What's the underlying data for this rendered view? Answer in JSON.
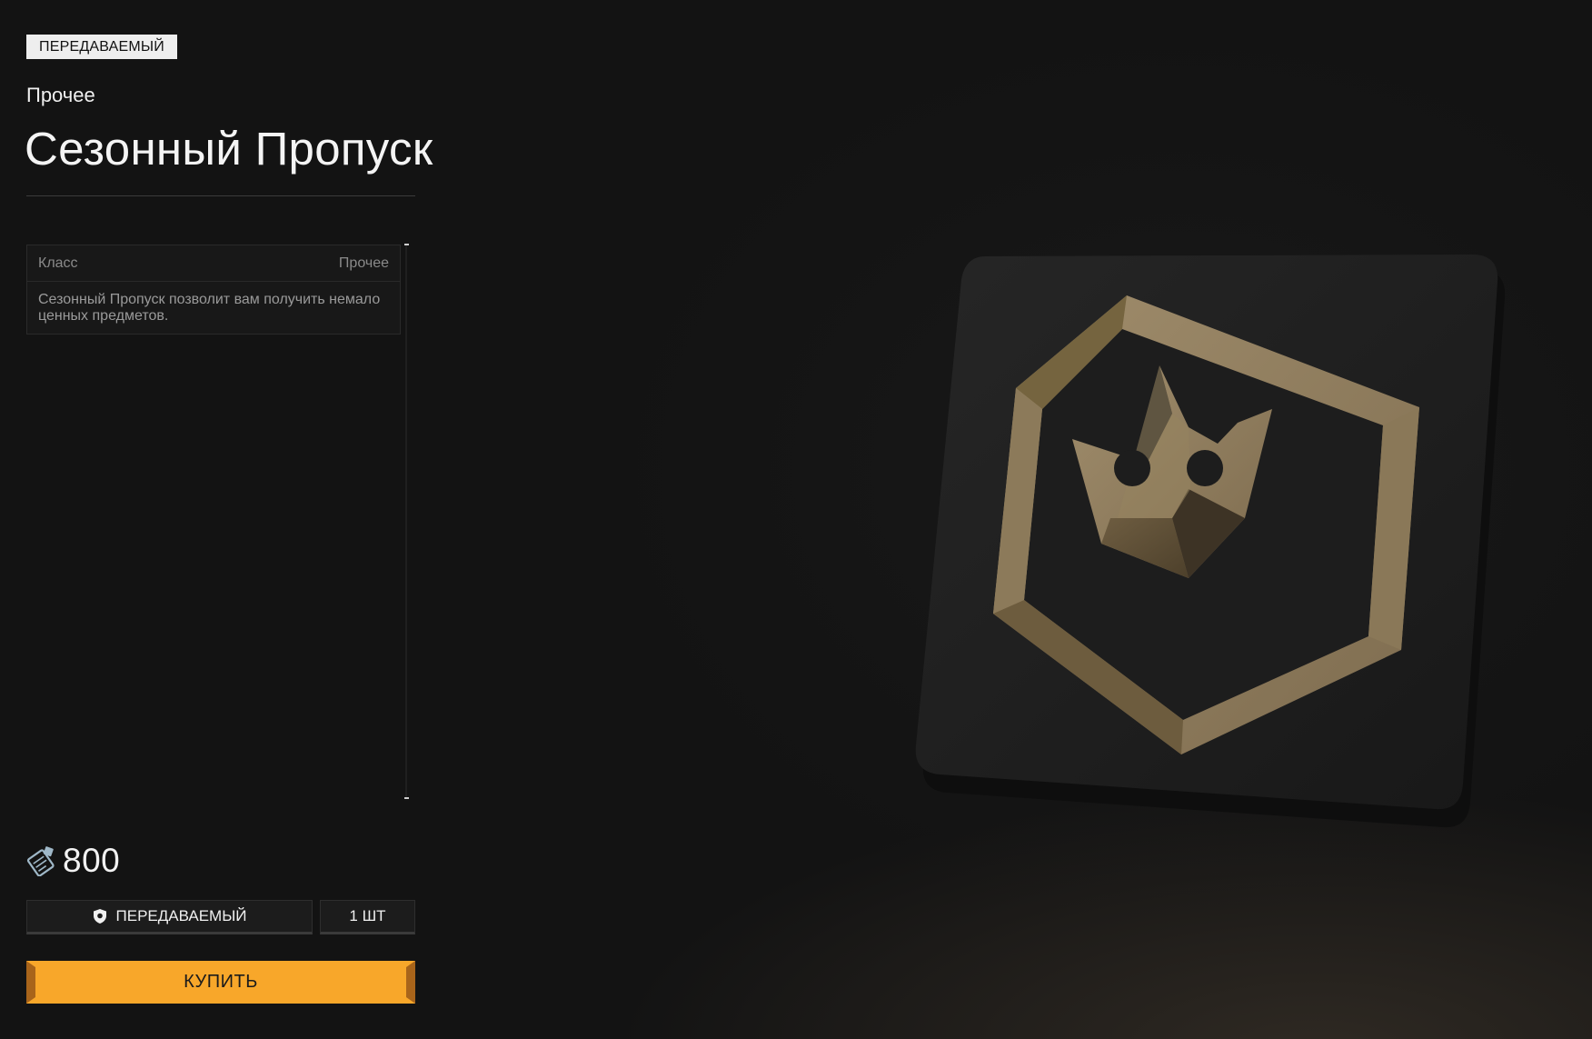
{
  "item": {
    "tag": "ПЕРЕДАВАЕМЫЙ",
    "category": "Прочее",
    "title": "Сезонный Пропуск"
  },
  "info": {
    "class_label": "Класс",
    "class_value": "Прочее",
    "description": "Сезонный Пропуск позволит вам получить немало ценных предметов."
  },
  "purchase": {
    "price": "800",
    "currency_icon": "ticket-icon",
    "transfer_label": "ПЕРЕДАВАЕМЫЙ",
    "transfer_icon": "shield-icon",
    "quantity": "1 ШТ",
    "buy_label": "КУПИТЬ"
  },
  "preview": {
    "icon": "crown-hexagon-emblem",
    "accent_color": "#f8a72a",
    "emblem_color": "#8a7656"
  }
}
